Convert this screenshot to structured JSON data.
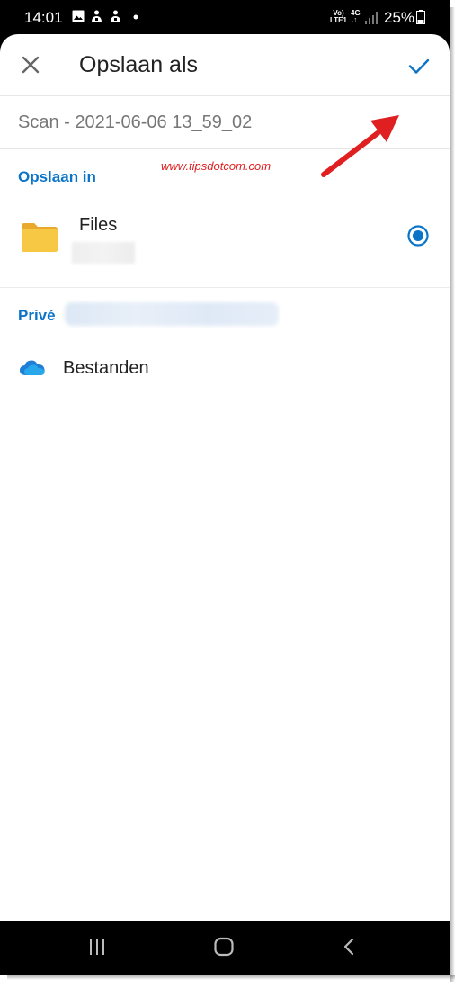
{
  "status_bar": {
    "time": "14:01",
    "volte_line1": "Vo)",
    "volte_line2": "LTE1",
    "network": "4G",
    "battery": "25%",
    "icons": [
      "gallery-icon",
      "notification-icon",
      "notification-icon",
      "dot-icon",
      "signal-icon",
      "battery-icon"
    ]
  },
  "header": {
    "title": "Opslaan als",
    "close_icon": "close-icon",
    "confirm_icon": "checkmark-icon"
  },
  "filename": {
    "value": "Scan - 2021-06-06 13_59_02"
  },
  "watermark": "www.tipsdotcom.com",
  "save_in": {
    "header": "Opslaan in",
    "location": {
      "label": "Files",
      "icon": "folder-icon",
      "selected": true
    }
  },
  "private": {
    "header": "Privé",
    "items": [
      {
        "label": "Bestanden",
        "icon": "onedrive-cloud-icon"
      }
    ]
  },
  "nav_bar": {
    "buttons": [
      "recent-apps-icon",
      "home-icon",
      "back-icon"
    ]
  },
  "colors": {
    "accent": "#0a74c9",
    "annotation": "#e02020",
    "folder": "#f7c844"
  }
}
